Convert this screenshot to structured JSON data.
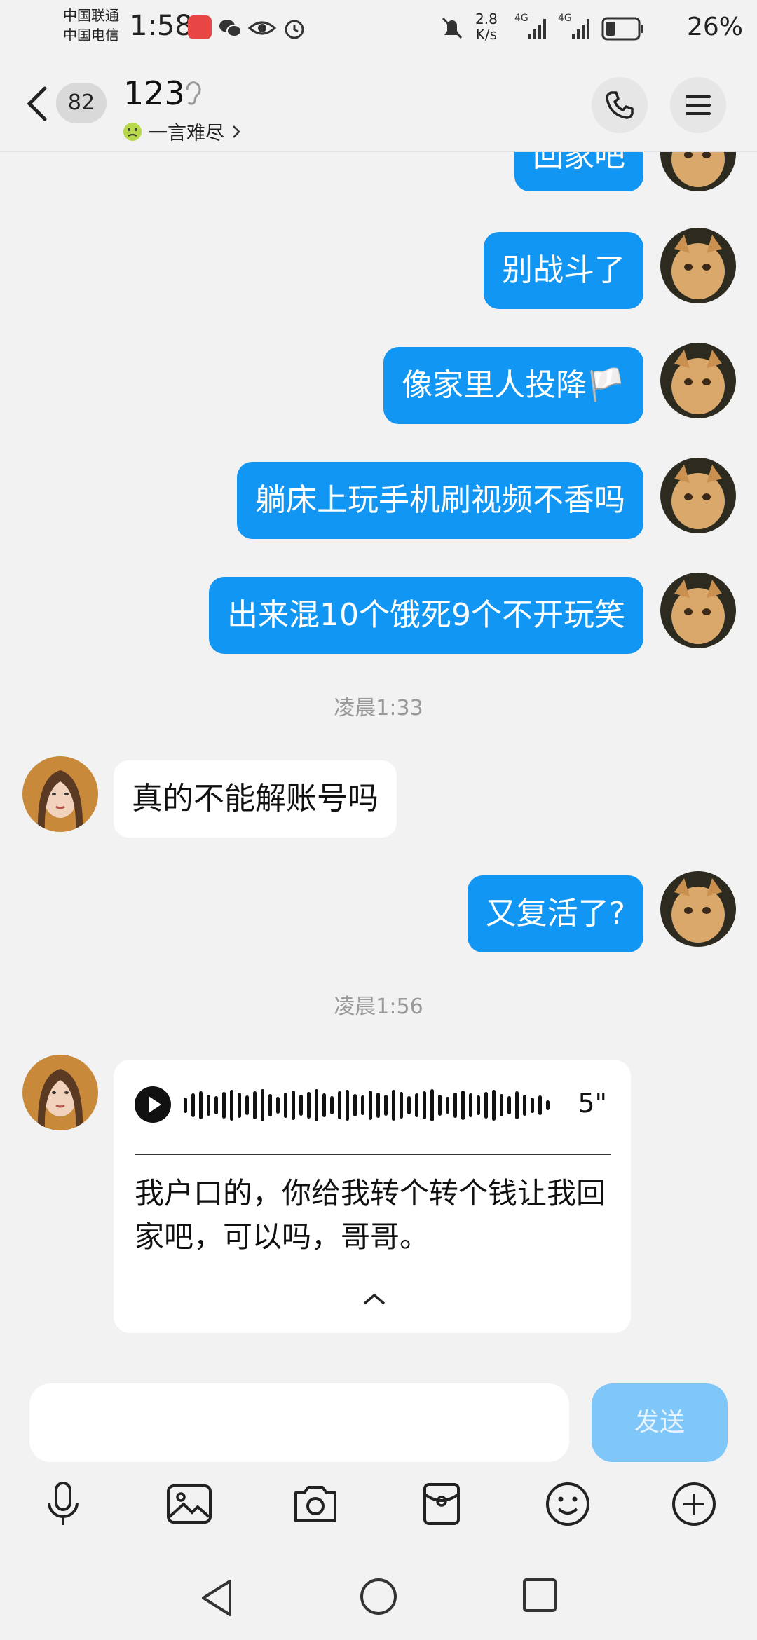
{
  "status_bar": {
    "carrier1": "中国联通",
    "carrier2": "中国电信",
    "time": "1:58",
    "net_speed_value": "2.8",
    "net_speed_unit": "K/s",
    "signal1": "4G",
    "signal2": "4G",
    "battery": "26%"
  },
  "header": {
    "unread_count": "82",
    "title": "123",
    "subtitle": "一言难尽"
  },
  "messages": {
    "out1": "回家吧",
    "out2": "别战斗了",
    "out3": "像家里人投降🏳️",
    "out4": "躺床上玩手机刷视频不香吗",
    "out5": "出来混10个饿死9个不开玩笑",
    "time1": "凌晨1:33",
    "in1": "真的不能解账号吗",
    "out6": "又复活了?",
    "time2": "凌晨1:56",
    "voice_duration": "5\"",
    "voice_transcript": "我户口的，你给我转个转个钱让我回家吧，可以吗，哥哥。"
  },
  "input": {
    "placeholder": "",
    "send_label": "发送"
  },
  "colors": {
    "outgoing_bubble": "#1296f3",
    "send_disabled": "#7fc6f9",
    "background": "#f2f2f2"
  }
}
